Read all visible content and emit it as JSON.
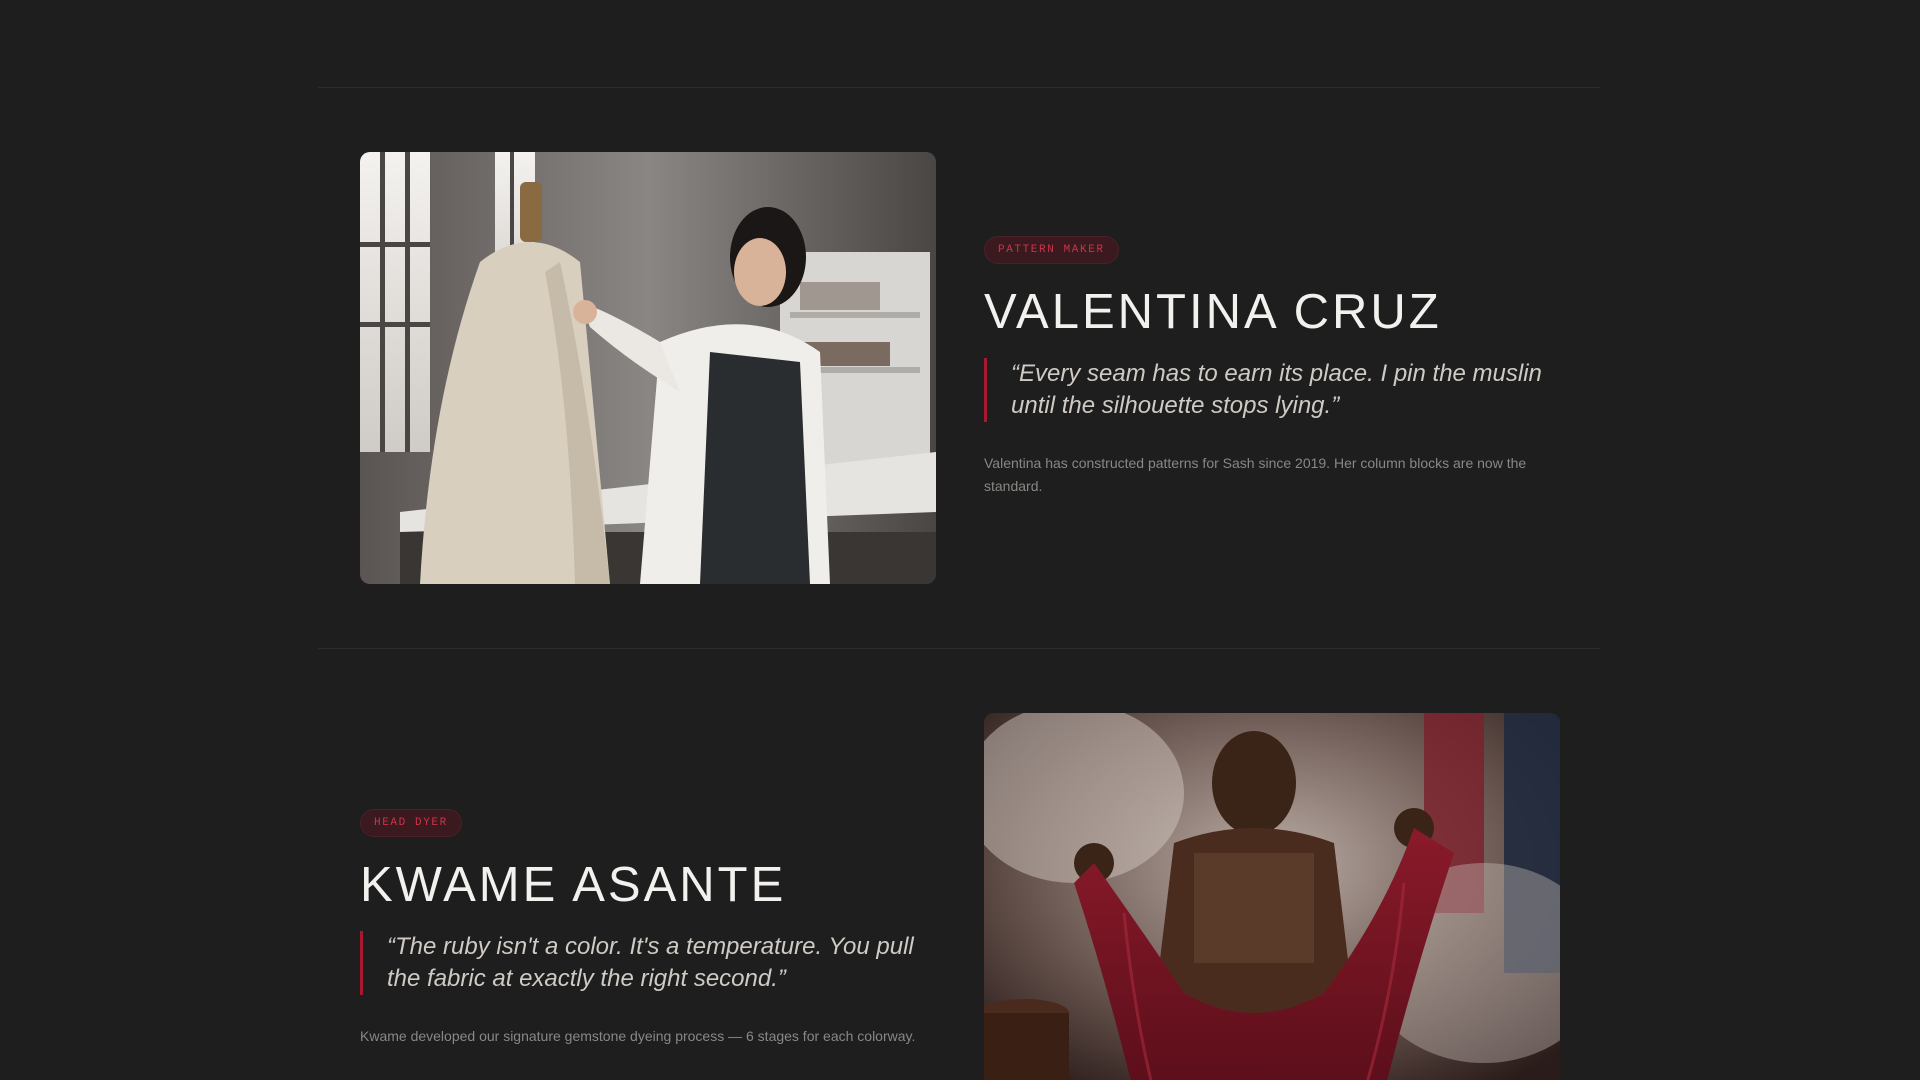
{
  "members": [
    {
      "role": "PATTERN MAKER",
      "name": "VALENTINA CRUZ",
      "quote": "“Every seam has to earn its place. I pin the muslin until the silhouette stops lying.”",
      "bio": "Valentina has constructed patterns for Sash since 2019. Her column blocks are now the standard.",
      "image_icon": "photo-pattern-maker-at-dress-form"
    },
    {
      "role": "HEAD DYER",
      "name": "KWAME ASANTE",
      "quote": "“The ruby isn't a color. It's a temperature. You pull the fabric at exactly the right second.”",
      "bio": "Kwame developed our signature gemstone dyeing process — 6 stages for each colorway.",
      "image_icon": "photo-dyer-with-ruby-fabric"
    }
  ],
  "colors": {
    "background": "#1e1e1e",
    "accent": "#a8182e",
    "badge_text": "#c9344a",
    "name_text": "#f3f1ee",
    "quote_text": "#cfcac4",
    "bio_text": "#8a8784"
  }
}
